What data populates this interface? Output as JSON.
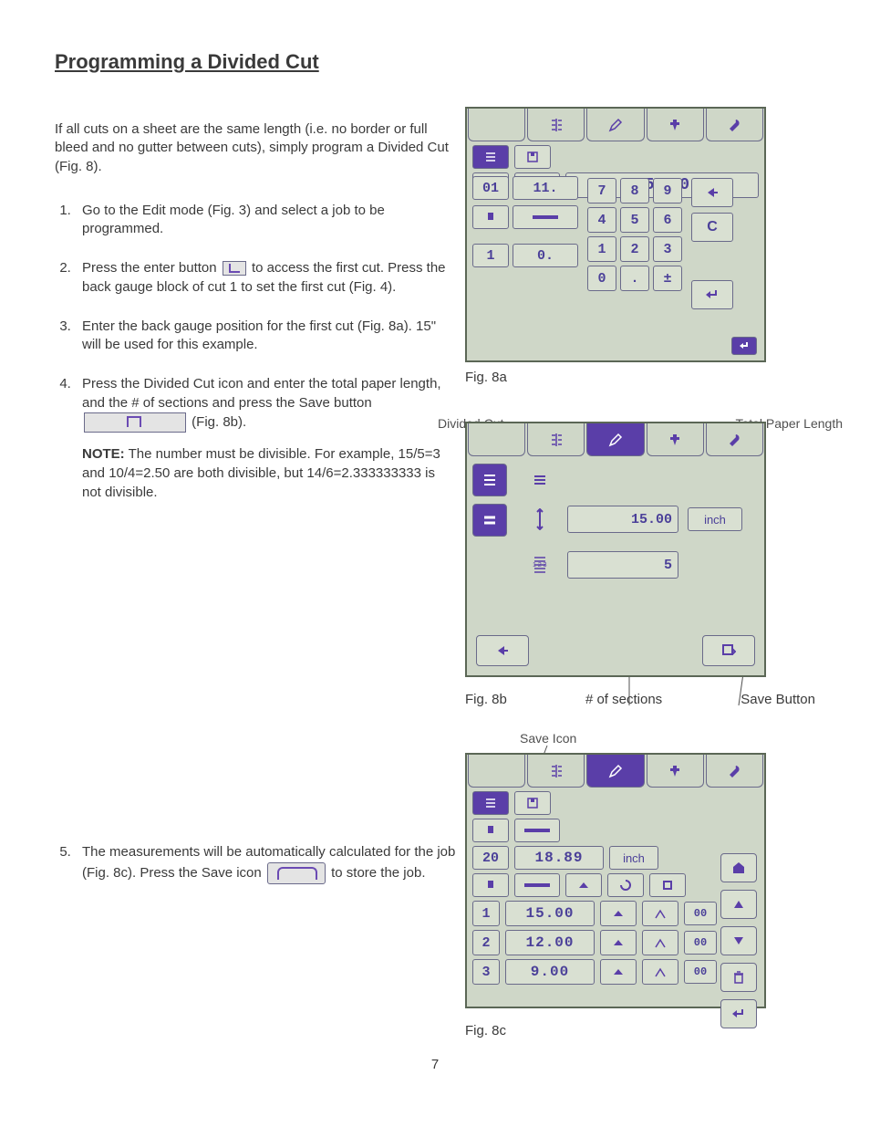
{
  "title": "Programming a Divided Cut",
  "intro": "If all cuts on a sheet are the same length (i.e. no border or full bleed and no gutter between cuts), simply program a Divided Cut (Fig. 8).",
  "steps": {
    "s1": "Go to the Edit mode (Fig. 3) and select a job to be programmed.",
    "s2a": "Press the enter button",
    "s2b": "to access the first cut. Press the back gauge block of cut 1 to set the first cut (Fig. 4).",
    "s3": "Enter the back gauge position for the first cut (Fig. 8a). 15\" will be used for this example.",
    "s4a": "Press the Divided Cut icon and enter the total paper length, and the # of sections and press the Save button",
    "s4b": "(Fig. 8b).",
    "s4_note_label": "NOTE:",
    "s4_note": " The number must be divisible. For example, 15/5=3 and 10/4=2.50 are both divisible, but 14/6=2.333333333 is not divisible.",
    "s5a": "The measurements will be automatically calculated for the job (Fig. 8c).  Press the Save icon",
    "s5b": "to store the job."
  },
  "fig8a": {
    "caption": "Fig. 8a",
    "display": "15.00",
    "rowA_1": "01",
    "rowA_2": "11.",
    "rowB_1": "1",
    "rowB_2": "0.",
    "keypad": [
      "7",
      "8",
      "9",
      "4",
      "5",
      "6",
      "1",
      "2",
      "3",
      "0",
      ".",
      "±"
    ],
    "side_clear": "C"
  },
  "fig8b": {
    "caption": "Fig. 8b",
    "callout_divided": "Divided Cut",
    "callout_total": "Total Paper Length",
    "callout_sections": "# of sections",
    "callout_save": "Save Button",
    "total_length": "15.00",
    "unit": "inch",
    "sections": "5"
  },
  "fig8c": {
    "caption": "Fig. 8c",
    "callout_save_icon": "Save Icon",
    "gauge_idx": "20",
    "gauge_val": "18.89",
    "gauge_unit": "inch",
    "rows": [
      {
        "idx": "1",
        "val": "15.00",
        "sm": "00"
      },
      {
        "idx": "2",
        "val": "12.00",
        "sm": "00"
      },
      {
        "idx": "3",
        "val": "9.00",
        "sm": "00"
      }
    ]
  },
  "page_number": "7"
}
